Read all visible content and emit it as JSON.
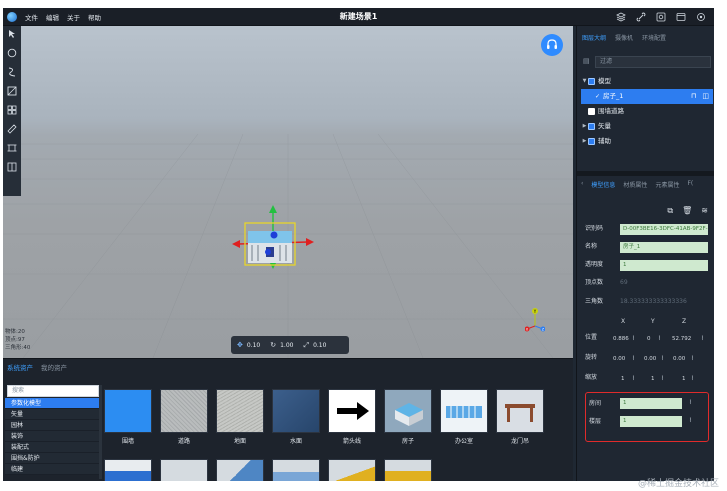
{
  "menu": [
    "文件",
    "编辑",
    "关于",
    "帮助"
  ],
  "scene_title": "新建场景1",
  "top_tools": [
    "layers-icon",
    "link-icon",
    "capture-icon",
    "screen-icon",
    "settings-icon"
  ],
  "viewport": {
    "stats": [
      "物体:20",
      "顶点:97",
      "三角形:40"
    ],
    "toolbar": {
      "move": "0.10",
      "rotate": "1.00",
      "scale": "0.10"
    },
    "axis_labels": {
      "y": "Y",
      "x": "X",
      "z": "Z"
    }
  },
  "assets": {
    "tabs": [
      "系统资产",
      "我的资产"
    ],
    "search_placeholder": "搜索",
    "categories": [
      "参数化模型",
      "矢量",
      "园林",
      "装饰",
      "装配式",
      "围挡&防护",
      "临建"
    ],
    "items": [
      {
        "label": "围墙",
        "color": "#2c8df2"
      },
      {
        "label": "道路",
        "color": "#b9bcbd"
      },
      {
        "label": "地面",
        "color": "#c6c8c5"
      },
      {
        "label": "水面",
        "color": "#3c5f8c"
      },
      {
        "label": "箭头线",
        "color": "#ffffff"
      },
      {
        "label": "房子",
        "color": "#8fa8bd"
      },
      {
        "label": "办公室",
        "color": "#eef3f7"
      },
      {
        "label": "龙门吊",
        "color": "#d9dee4"
      }
    ],
    "row2_colors": [
      "#2c6fd0",
      "#2d3540",
      "#2d3540",
      "#2d3540",
      "#2d3540",
      "#2d3540"
    ]
  },
  "right": {
    "tabs": [
      "图层大纲",
      "摄像机",
      "环境配置"
    ],
    "search_placeholder": "过滤",
    "tree": [
      {
        "label": "模型",
        "checked": true,
        "expanded": true,
        "level": 0
      },
      {
        "label": "房子_1",
        "checked": true,
        "level": 1,
        "selected": true
      },
      {
        "label": "围墙道路",
        "checked": false,
        "level": 0
      },
      {
        "label": "矢量",
        "checked": true,
        "level": 0
      },
      {
        "label": "辅助",
        "checked": true,
        "level": 0
      }
    ],
    "prop_tabs": [
      "模型信息",
      "材质属性",
      "元素属性",
      "F("
    ],
    "props": {
      "id_label": "识别码",
      "id_value": "D-00F3BE16-3DFC-41AB-9F2F-",
      "name_label": "名称",
      "name_value": "房子_1",
      "opacity_label": "透明度",
      "opacity_value": "1",
      "vertex_label": "顶点数",
      "vertex_value": "69",
      "triangle_label": "三角数",
      "triangle_value": "18.333333333333336",
      "axes": [
        "X",
        "Y",
        "Z"
      ],
      "position_label": "位置",
      "position": [
        "0.886",
        "0",
        "52.792"
      ],
      "rotation_label": "旋转",
      "rotation": [
        "0.00",
        "0.00",
        "0.00"
      ],
      "scale_label": "缩放",
      "scale": [
        "1",
        "1",
        "1"
      ],
      "room_label": "房间",
      "room_value": "1",
      "floor_label": "楼层",
      "floor_value": "1"
    }
  },
  "watermark": "@稀土掘金技术社区"
}
